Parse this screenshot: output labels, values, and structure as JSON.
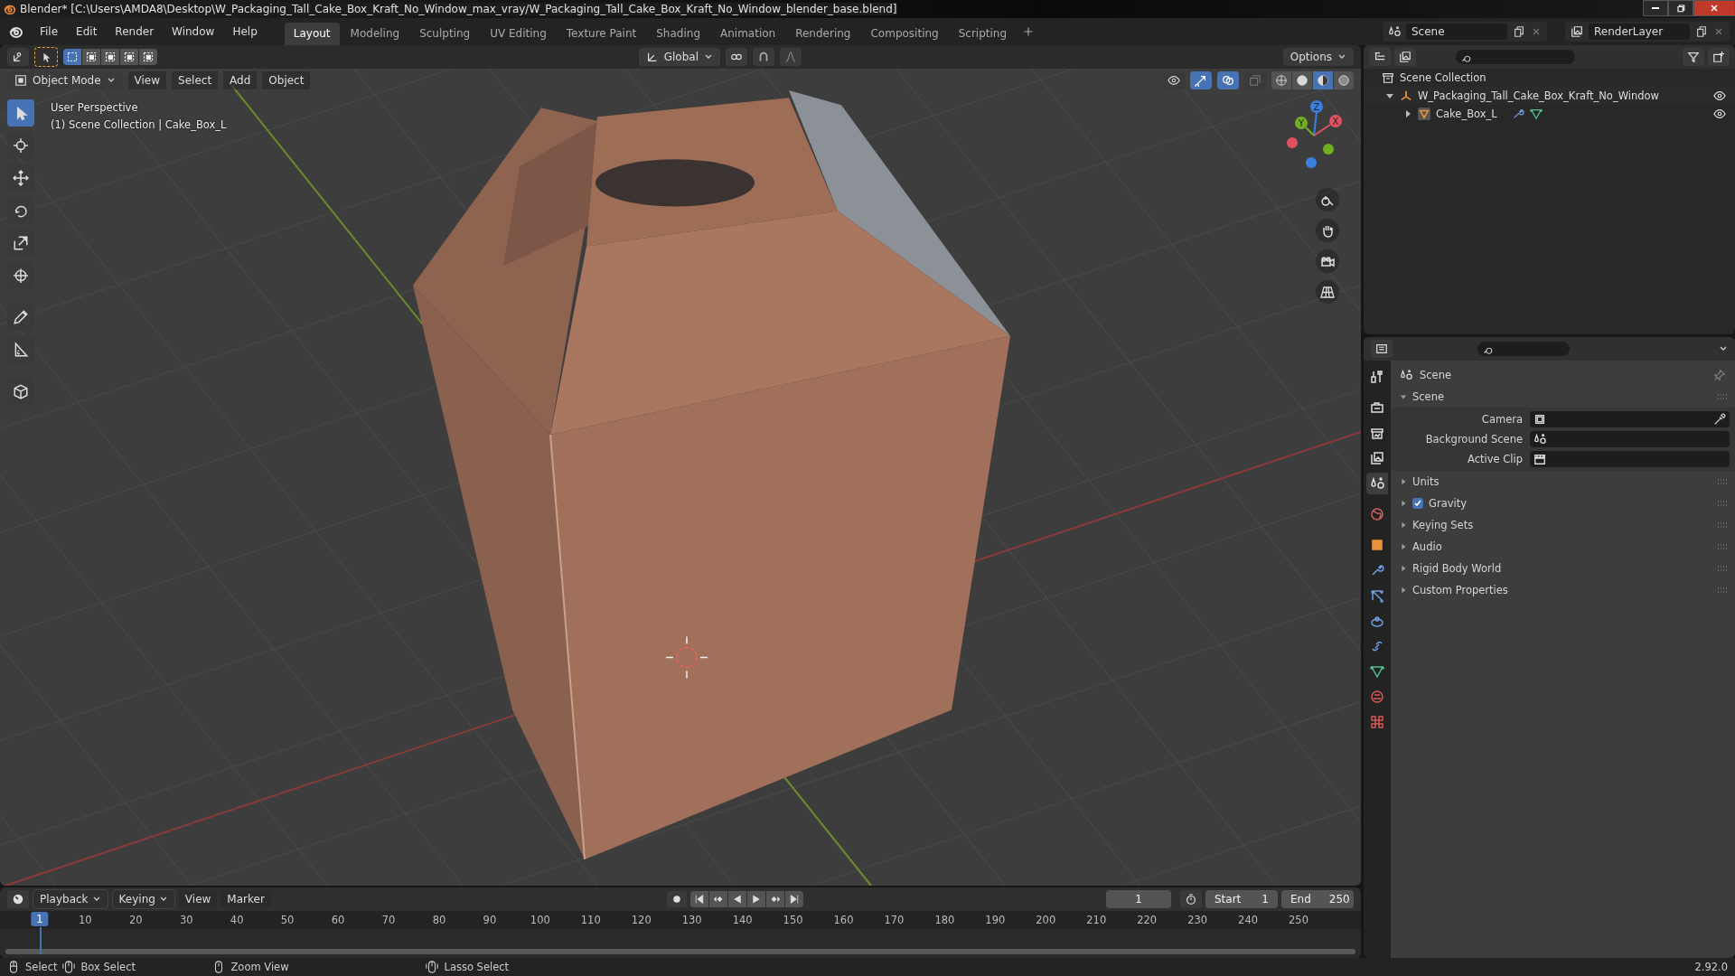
{
  "window": {
    "title": "Blender* [C:\\Users\\AMDA8\\Desktop\\W_Packaging_Tall_Cake_Box_Kraft_No_Window_max_vray/W_Packaging_Tall_Cake_Box_Kraft_No_Window_blender_base.blend]"
  },
  "menu": [
    "File",
    "Edit",
    "Render",
    "Window",
    "Help"
  ],
  "workspaces": [
    {
      "label": "Layout",
      "selected": true
    },
    {
      "label": "Modeling",
      "selected": false
    },
    {
      "label": "Sculpting",
      "selected": false
    },
    {
      "label": "UV Editing",
      "selected": false
    },
    {
      "label": "Texture Paint",
      "selected": false
    },
    {
      "label": "Shading",
      "selected": false
    },
    {
      "label": "Animation",
      "selected": false
    },
    {
      "label": "Rendering",
      "selected": false
    },
    {
      "label": "Compositing",
      "selected": false
    },
    {
      "label": "Scripting",
      "selected": false
    }
  ],
  "scene": {
    "name": "Scene",
    "view_layer": "RenderLayer"
  },
  "viewport": {
    "transform_orientation": "Global",
    "options": "Options",
    "mode": "Object Mode",
    "menus": [
      "View",
      "Select",
      "Add",
      "Object"
    ],
    "info": [
      "User Perspective",
      "(1) Scene Collection | Cake_Box_L"
    ],
    "select_modes": [
      {
        "selected": true
      },
      {
        "selected": false
      },
      {
        "selected": false
      },
      {
        "selected": false
      },
      {
        "selected": false
      }
    ],
    "tools": [
      {
        "kind": "select",
        "selected": true
      },
      {
        "kind": "cursor",
        "selected": false
      },
      {
        "kind": "move",
        "selected": false
      },
      {
        "kind": "rotate",
        "selected": false
      },
      {
        "kind": "scale",
        "selected": false
      },
      {
        "kind": "transform",
        "selected": false
      },
      {
        "kind": "annotate",
        "selected": false
      },
      {
        "kind": "measure",
        "selected": false
      },
      {
        "kind": "add_cube",
        "selected": false
      }
    ],
    "shading": [
      {
        "kind": "wireframe",
        "selected": false
      },
      {
        "kind": "solid",
        "selected": false
      },
      {
        "kind": "material",
        "selected": true
      },
      {
        "kind": "rendered",
        "selected": false
      }
    ],
    "gizmo_axes": [
      "X",
      "Y",
      "Z"
    ]
  },
  "outliner": {
    "root": "Scene Collection",
    "items": [
      {
        "label": "W_Packaging_Tall_Cake_Box_Kraft_No_Window",
        "kind": "empty",
        "expanded": true,
        "children": [
          {
            "label": "Cake_Box_L",
            "kind": "mesh",
            "expanded": false
          }
        ]
      }
    ]
  },
  "properties": {
    "context": "Scene",
    "tabs": [
      {
        "kind": "tool",
        "selected": false
      },
      {
        "kind": "render",
        "selected": false
      },
      {
        "kind": "output",
        "selected": false
      },
      {
        "kind": "view_layer",
        "selected": false
      },
      {
        "kind": "scene",
        "selected": true
      },
      {
        "kind": "world",
        "selected": false
      },
      {
        "kind": "object",
        "selected": false
      },
      {
        "kind": "modifiers",
        "selected": false
      },
      {
        "kind": "particles",
        "selected": false
      },
      {
        "kind": "physics",
        "selected": false
      },
      {
        "kind": "constraints",
        "selected": false
      },
      {
        "kind": "data",
        "selected": false
      },
      {
        "kind": "material",
        "selected": false
      },
      {
        "kind": "texture",
        "selected": false
      }
    ],
    "panels": [
      {
        "label": "Scene",
        "kind": "plain",
        "expanded": true,
        "fields": [
          {
            "label": "Camera",
            "kind": "camera"
          },
          {
            "label": "Background Scene",
            "kind": "scene"
          },
          {
            "label": "Active Clip",
            "kind": "clip"
          }
        ]
      },
      {
        "label": "Units",
        "kind": "plain",
        "expanded": false
      },
      {
        "label": "Gravity",
        "kind": "checkbox",
        "checked": true,
        "expanded": false
      },
      {
        "label": "Keying Sets",
        "kind": "plain",
        "expanded": false
      },
      {
        "label": "Audio",
        "kind": "plain",
        "expanded": false
      },
      {
        "label": "Rigid Body World",
        "kind": "plain",
        "expanded": false
      },
      {
        "label": "Custom Properties",
        "kind": "plain",
        "expanded": false
      }
    ]
  },
  "timeline": {
    "menus": [
      "Playback",
      "Keying",
      "View",
      "Marker"
    ],
    "current_frame": "1",
    "start_label": "Start",
    "start": "1",
    "end_label": "End",
    "end": "250",
    "playhead": "1",
    "ticks": [
      "10",
      "20",
      "30",
      "40",
      "50",
      "60",
      "70",
      "80",
      "90",
      "100",
      "110",
      "120",
      "130",
      "140",
      "150",
      "160",
      "170",
      "180",
      "190",
      "200",
      "210",
      "220",
      "230",
      "240",
      "250"
    ]
  },
  "status_bar": {
    "hints": [
      "Select",
      "Box Select",
      "Zoom View",
      "Lasso Select"
    ],
    "version": "2.92.0"
  }
}
